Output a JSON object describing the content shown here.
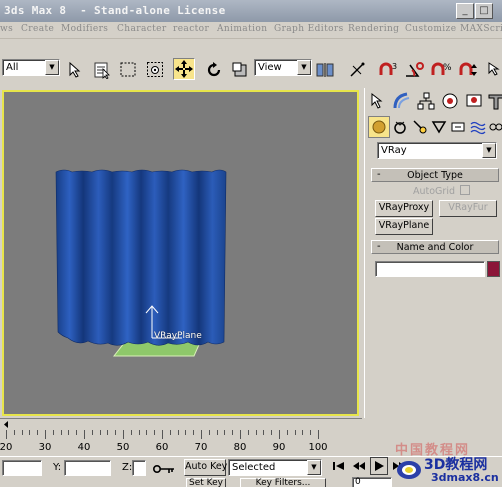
{
  "app": {
    "title": "3ds Max 8  - Stand-alone License",
    "window_buttons": [
      "_",
      "□",
      "×"
    ]
  },
  "menu": {
    "items": [
      "ws",
      "Create",
      "Modifiers",
      "Character",
      "reactor",
      "Animation",
      "Graph Editors",
      "Rendering",
      "Customize",
      "MAXScript"
    ]
  },
  "toolbar": {
    "selection_filter": "All",
    "reference_coord": "View"
  },
  "viewport": {
    "object_label": "VRayPlane",
    "curtain_color": "#1f4fa6",
    "plane_color": "#8ec86a",
    "border_color": "#e7e54a"
  },
  "command_panel": {
    "category": "VRay",
    "object_type": {
      "header": "Object Type",
      "sign": "-",
      "autogrid_label": "AutoGrid",
      "buttons": [
        "VRayProxy",
        "VRayFur",
        "VRayPlane"
      ]
    },
    "name_and_color": {
      "header": "Name and Color",
      "sign": "-",
      "name_value": "",
      "color": "#8b1538"
    }
  },
  "timeline": {
    "labels": [
      "20",
      "30",
      "40",
      "50",
      "60",
      "70",
      "80",
      "90",
      "100"
    ]
  },
  "status": {
    "y_label": "Y:",
    "z_label": "Z:",
    "x_value": "",
    "y_value": "",
    "z_value": "",
    "auto_key_label": "Auto Key",
    "set_key_label": "Set Key",
    "key_mode": "Selected",
    "key_filters_label": "Key Filters...",
    "frame_value": "0",
    "watermark_cn": "中国教程网",
    "watermark_logo": "3D教程网",
    "watermark_url": "3dmax8.cn"
  }
}
